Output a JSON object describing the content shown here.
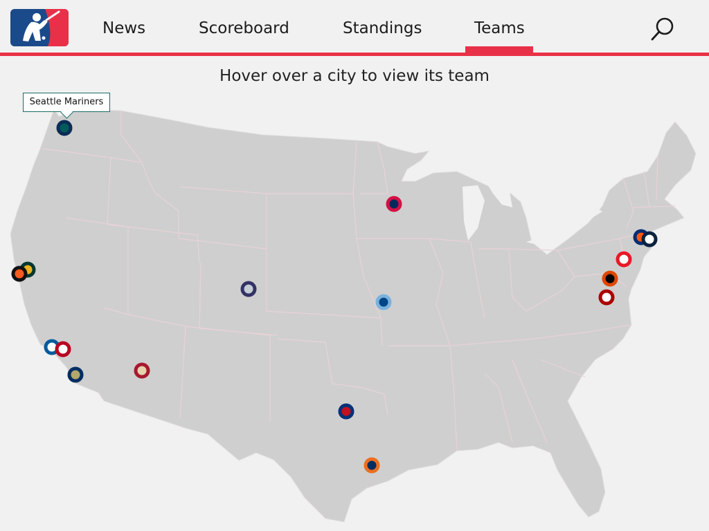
{
  "nav": {
    "tabs": [
      "News",
      "Scoreboard",
      "Standings",
      "Teams"
    ],
    "active_tab": "Teams",
    "accent_color": "#e83148"
  },
  "icons": {
    "logo": "mlb-logo-icon",
    "search": "search-icon"
  },
  "map": {
    "heading": "Hover over a city to view its team",
    "tooltip": "Seattle Mariners",
    "land_color": "#cfcfcf",
    "border_color": "#ead2d6"
  },
  "team_markers": [
    {
      "team": "Seattle Mariners",
      "ring": "#0c2c56",
      "fill": "#005c5c"
    },
    {
      "team": "Minnesota Twins",
      "ring": "#d31145",
      "fill": "#002b5c"
    },
    {
      "team": "Oakland Athletics",
      "ring": "#003831",
      "fill": "#efb21e"
    },
    {
      "team": "San Francisco Giants",
      "ring": "#111111",
      "fill": "#fd5a1e"
    },
    {
      "team": "Colorado Rockies",
      "ring": "#333366",
      "fill": "#c4ced4"
    },
    {
      "team": "Kansas City Royals",
      "ring": "#7ab2dd",
      "fill": "#004687"
    },
    {
      "team": "Los Angeles Dodgers",
      "ring": "#005a9c",
      "fill": "#ffffff"
    },
    {
      "team": "Los Angeles Angels",
      "ring": "#ba0021",
      "fill": "#ffffff"
    },
    {
      "team": "San Diego Padres",
      "ring": "#002d62",
      "fill": "#b4a76c"
    },
    {
      "team": "Arizona Diamondbacks",
      "ring": "#a71930",
      "fill": "#e3d4ad"
    },
    {
      "team": "Texas Rangers",
      "ring": "#003278",
      "fill": "#c0111f"
    },
    {
      "team": "Houston Astros",
      "ring": "#eb6e1f",
      "fill": "#002d62"
    },
    {
      "team": "New York Mets",
      "ring": "#002d72",
      "fill": "#ff5910"
    },
    {
      "team": "New York Yankees",
      "ring": "#0c2340",
      "fill": "#ffffff"
    },
    {
      "team": "Philadelphia Phillies",
      "ring": "#e81828",
      "fill": "#ffffff"
    },
    {
      "team": "Baltimore Orioles",
      "ring": "#df4601",
      "fill": "#000000"
    },
    {
      "team": "Washington Nationals",
      "ring": "#ab0003",
      "fill": "#ffffff"
    }
  ]
}
